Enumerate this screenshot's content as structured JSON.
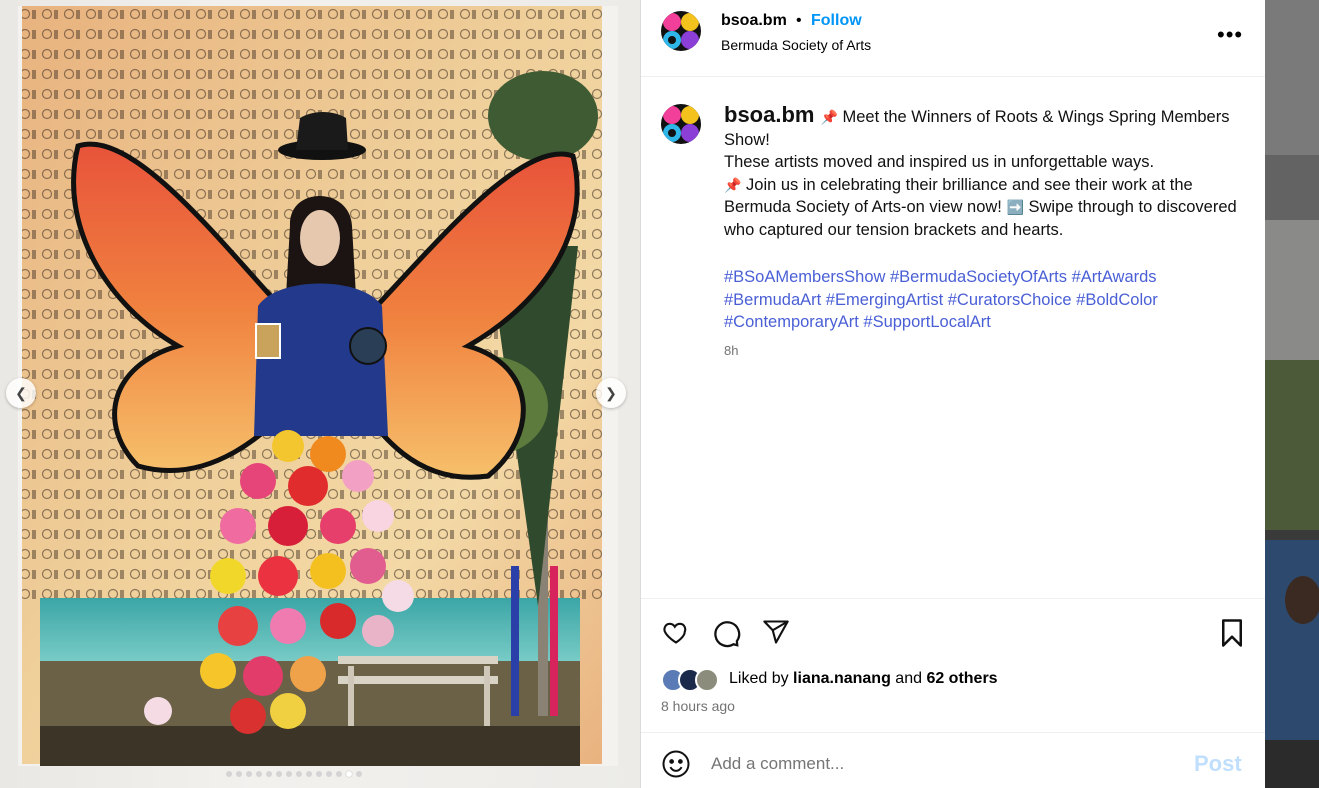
{
  "post": {
    "username": "bsoa.bm",
    "separator": "•",
    "follow_label": "Follow",
    "subtitle": "Bermuda Society of Arts",
    "more_label": "•••"
  },
  "caption": {
    "username": "bsoa.bm",
    "line1": " Meet the Winners of Roots & Wings Spring Members Show!",
    "line2": "These artists moved and inspired us in unforgettable ways.",
    "line3": " Join us in celebrating their brilliance and see their work at the Bermuda Society of Arts-on view now! ",
    "line3b": " Swipe through to discovered who captured our tension brackets and hearts.",
    "pin_emoji": "📌",
    "arrow_emoji": "➡️",
    "hashtags": "#BSoAMembersShow #BermudaSocietyOfArts #ArtAwards #BermudaArt #EmergingArtist #CuratorsChoice #BoldColor #ContemporaryArt #SupportLocalArt",
    "time": "8h"
  },
  "engagement": {
    "liked_prefix": "Liked by ",
    "liked_user": "liana.nanang",
    "liked_mid": " and ",
    "liked_others": "62 others",
    "time": "8 hours ago"
  },
  "comment": {
    "placeholder": "Add a comment...",
    "post_label": "Post"
  },
  "carousel": {
    "total": 14,
    "active_index": 12
  },
  "colors": {
    "accent": "#0095f6",
    "hashtag": "#4a5fd6",
    "muted": "#737373",
    "post_disabled": "#c0dffd"
  },
  "icons": [
    "chevron-left-icon",
    "chevron-right-icon",
    "more-icon",
    "heart-icon",
    "comment-icon",
    "share-icon",
    "bookmark-icon",
    "emoji-icon"
  ]
}
